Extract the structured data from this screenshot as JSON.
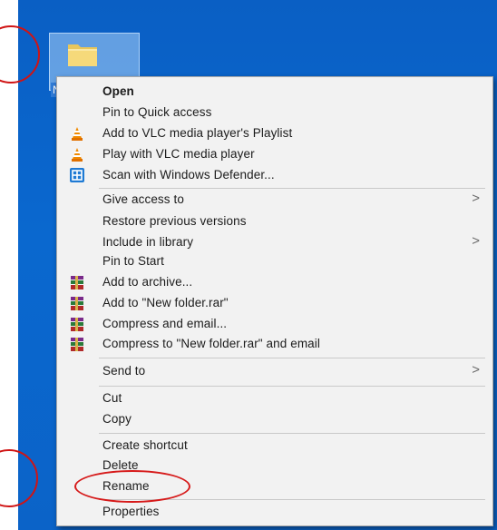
{
  "desktop": {
    "folder_label": "Ne",
    "colors": {
      "desktop_bg": "#0a5fc4",
      "annotation": "#d01414"
    }
  },
  "context_menu": {
    "items": [
      {
        "label": "Open",
        "icon": ""
      },
      {
        "label": "Pin to Quick access",
        "icon": ""
      },
      {
        "label": "Add to VLC media player's Playlist",
        "icon": "vlc-cone-icon"
      },
      {
        "label": "Play with VLC media player",
        "icon": "vlc-cone-icon"
      },
      {
        "label": "Scan with Windows Defender...",
        "icon": "windows-defender-icon"
      },
      {
        "label": "Give access to",
        "icon": "",
        "submenu": ">"
      },
      {
        "label": "Restore previous versions",
        "icon": ""
      },
      {
        "label": "Include in library",
        "icon": "",
        "submenu": ">"
      },
      {
        "label": "Pin to Start",
        "icon": ""
      },
      {
        "label": "Add to archive...",
        "icon": "winrar-books-icon"
      },
      {
        "label": "Add to \"New folder.rar\"",
        "icon": "winrar-books-icon"
      },
      {
        "label": "Compress and email...",
        "icon": "winrar-books-icon"
      },
      {
        "label": "Compress to \"New folder.rar\" and email",
        "icon": "winrar-books-icon"
      },
      {
        "label": "Send to",
        "icon": "",
        "submenu": ">"
      },
      {
        "label": "Cut",
        "icon": ""
      },
      {
        "label": "Copy",
        "icon": ""
      },
      {
        "label": "Create shortcut",
        "icon": ""
      },
      {
        "label": "Delete",
        "icon": ""
      },
      {
        "label": "Rename",
        "icon": ""
      },
      {
        "label": "Properties",
        "icon": ""
      }
    ]
  }
}
